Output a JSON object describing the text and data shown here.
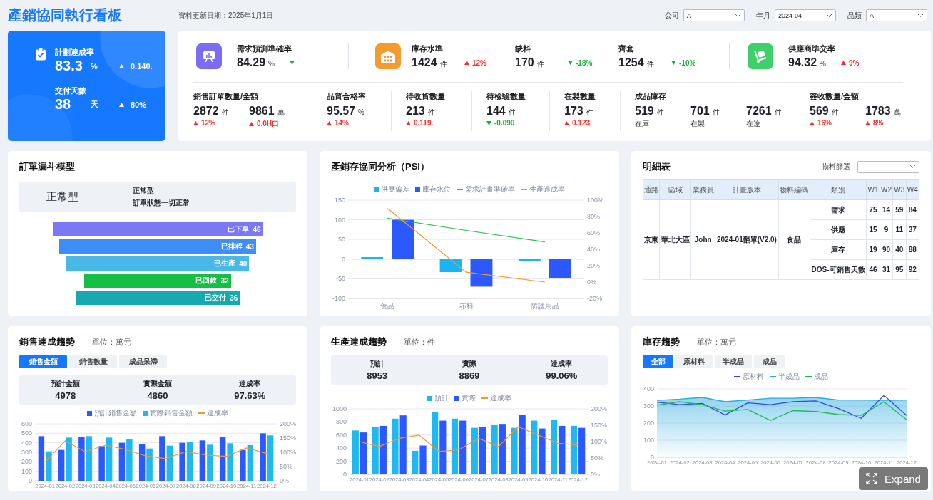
{
  "header": {
    "title": "產銷協同執行看板",
    "update_date": "資料更新日期：2025年1月1日",
    "filters": [
      {
        "label": "公司",
        "value": "A"
      },
      {
        "label": "年月",
        "value": "2024-04"
      },
      {
        "label": "品類",
        "value": "A"
      }
    ]
  },
  "summary_card": {
    "metrics": [
      {
        "label": "計劃達成率",
        "value": "83.3",
        "unit": "%",
        "change": "0.140.",
        "rising": true
      },
      {
        "label": "交付天數",
        "value": "38",
        "unit": "天",
        "change": "80%",
        "rising": true
      }
    ]
  },
  "kpi_panel": {
    "top_groups": [
      {
        "color": "#7b6cf6",
        "items": [
          {
            "label": "需求預測準確率",
            "value": "84.29",
            "unit": "%",
            "rising": false
          }
        ]
      },
      {
        "color": "#f59a2f",
        "items": [
          {
            "label": "庫存水準",
            "value": "1424",
            "unit": "件",
            "change": "12%",
            "rising": true
          },
          {
            "label": "缺料",
            "value": "170",
            "unit": "件",
            "change": "-18%",
            "rising": false
          },
          {
            "label": "齊套",
            "value": "1254",
            "unit": "件",
            "change": "-10%",
            "rising": false
          }
        ]
      },
      {
        "color": "#3ecf6a",
        "items": [
          {
            "label": "供應商準交率",
            "value": "94.32",
            "unit": "%",
            "change": "9%",
            "rising": true
          }
        ]
      }
    ],
    "bottom_groups": [
      {
        "label": "銷售訂單數量/金額",
        "items": [
          {
            "value": "2872",
            "unit": "件",
            "change": "12%",
            "rising": true
          },
          {
            "value": "9861",
            "unit": "萬",
            "change": "0.0H口",
            "rising": true
          }
        ]
      },
      {
        "label": "品質合格率",
        "items": [
          {
            "value": "95.57",
            "unit": "%",
            "change": "14%",
            "rising": true
          }
        ]
      },
      {
        "label": "待收貨數量",
        "items": [
          {
            "value": "213",
            "unit": "件",
            "change": "0.119.",
            "rising": true
          }
        ]
      },
      {
        "label": "待檢驗數量",
        "items": [
          {
            "value": "144",
            "unit": "件",
            "change": "-0.090",
            "rising": false
          }
        ]
      },
      {
        "label": "在製數量",
        "items": [
          {
            "value": "173",
            "unit": "件",
            "change": "0.123.",
            "rising": true
          }
        ]
      },
      {
        "label": "成品庫存",
        "items": [
          {
            "value": "519",
            "unit": "件",
            "note": "在庫"
          },
          {
            "value": "701",
            "unit": "件",
            "note": "在製"
          },
          {
            "value": "7261",
            "unit": "件",
            "note": "在途"
          }
        ]
      },
      {
        "label": "簽收數量/金額",
        "items": [
          {
            "value": "569",
            "unit": "件",
            "change": "16%",
            "rising": true
          },
          {
            "value": "1783",
            "unit": "萬",
            "change": "8%",
            "rising": true
          }
        ]
      }
    ]
  },
  "funnel_panel": {
    "title": "訂單漏斗模型",
    "summary": {
      "type_label": "正常型",
      "name": "正常型",
      "description": "訂單狀態一切正常"
    },
    "stages": [
      {
        "label": "已下單",
        "value": "46",
        "color": "#7b77f5"
      },
      {
        "label": "已排程",
        "value": "43",
        "color": "#3d8ef8"
      },
      {
        "label": "已生產",
        "value": "40",
        "color": "#47b8e8"
      },
      {
        "label": "已回款",
        "value": "32",
        "color": "#16be45"
      },
      {
        "label": "已交付",
        "value": "36",
        "color": "#17a9b0"
      }
    ]
  },
  "psi_panel": {
    "title": "產銷存協同分析（PSI）",
    "chart_data": {
      "type": "bar",
      "grid": true,
      "categories": [
        "食品",
        "布料",
        "防護用品"
      ],
      "ylim": [
        -100,
        150
      ],
      "yticks": [
        -100,
        -50,
        0,
        50,
        100,
        150
      ],
      "y2lim": [
        -20,
        100
      ],
      "y2ticks": [
        {
          "value": -20,
          "label": "-20%"
        },
        {
          "value": 0,
          "label": "0%"
        },
        {
          "value": 20,
          "label": "20%"
        },
        {
          "value": 40,
          "label": "40%"
        },
        {
          "value": 60,
          "label": "60%"
        },
        {
          "value": 80,
          "label": "80%"
        },
        {
          "value": 100,
          "label": "100%"
        }
      ],
      "series": [
        {
          "name": "供應偏差",
          "type": "bar",
          "color": "#1ab4f0",
          "values": [
            5,
            -33,
            -5
          ]
        },
        {
          "name": "庫存水位",
          "type": "bar",
          "color": "#2b58ff",
          "values": [
            100,
            -70,
            -48
          ]
        },
        {
          "name": "需求計畫準確率",
          "type": "line",
          "axis": "y2",
          "color": "#2dbf4e",
          "values": [
            78,
            63,
            49
          ]
        },
        {
          "name": "生產達成率",
          "type": "line",
          "axis": "y2",
          "color": "#f39a2b",
          "values": [
            90,
            12,
            0
          ]
        }
      ]
    }
  },
  "detail_panel": {
    "title": "明細表",
    "filter_label": "物料篩選",
    "columns": [
      "通路",
      "區域",
      "業務員",
      "計畫版本",
      "物料編碼",
      "類別",
      "W1",
      "W2",
      "W3",
      "W4"
    ],
    "merged_cells": [
      "京東",
      "華北大區",
      "John",
      "2024-01翻單(V2.0)",
      "食品"
    ],
    "rows": [
      {
        "category": "需求",
        "values": [
          "75",
          "14",
          "59",
          "84"
        ]
      },
      {
        "category": "供應",
        "values": [
          "15",
          "9",
          "11",
          "37"
        ]
      },
      {
        "category": "庫存",
        "values": [
          "19",
          "90",
          "40",
          "88"
        ]
      },
      {
        "category": "DOS-可銷售天數",
        "values": [
          "46",
          "31",
          "95",
          "92"
        ]
      }
    ]
  },
  "sales_panel": {
    "title": "銷售達成趨勢",
    "unit": "單位：萬元",
    "tabs": [
      {
        "label": "銷售金額",
        "selected": true
      },
      {
        "label": "銷售數量",
        "selected": false
      },
      {
        "label": "成品呆滯",
        "selected": false
      }
    ],
    "stats": [
      {
        "label": "預計金額",
        "value": "4978"
      },
      {
        "label": "實際金額",
        "value": "4860"
      },
      {
        "label": "達成率",
        "value": "97.63%"
      }
    ],
    "chart_data": {
      "type": "bar",
      "grid": true,
      "categories": [
        "2024-01",
        "2024-02",
        "2024-03",
        "2024-04",
        "2024-05",
        "2024-06",
        "2024-07",
        "2024-08",
        "2024-09",
        "2024-10",
        "2024-11",
        "2024-12"
      ],
      "ylim": [
        0,
        600
      ],
      "yticks": [
        0,
        100,
        200,
        300,
        400,
        500,
        600
      ],
      "y2lim": [
        0,
        200
      ],
      "y2ticks": [
        {
          "value": 0,
          "label": "0%"
        },
        {
          "value": 50,
          "label": "50%"
        },
        {
          "value": 100,
          "label": "100%"
        },
        {
          "value": 150,
          "label": "150%"
        },
        {
          "value": 200,
          "label": "200%"
        }
      ],
      "series": [
        {
          "name": "預計銷售金額",
          "type": "bar",
          "color": "#2b58ff",
          "values": [
            470,
            325,
            460,
            365,
            400,
            390,
            470,
            400,
            425,
            460,
            325,
            500
          ]
        },
        {
          "name": "實際銷售金額",
          "type": "bar",
          "color": "#1fb8f0",
          "values": [
            310,
            455,
            470,
            455,
            440,
            340,
            370,
            410,
            380,
            395,
            375,
            478
          ]
        },
        {
          "name": "達成率",
          "type": "line",
          "axis": "y2",
          "color": "#f39a2b",
          "values": [
            66,
            140,
            102,
            125,
            110,
            87,
            78,
            103,
            90,
            86,
            115,
            96
          ]
        }
      ]
    }
  },
  "production_panel": {
    "title": "生產達成趨勢",
    "unit": "單位：件",
    "stats": [
      {
        "label": "預計",
        "value": "8953"
      },
      {
        "label": "實際",
        "value": "8869"
      },
      {
        "label": "達成率",
        "value": "99.06%"
      }
    ],
    "chart_data": {
      "type": "bar",
      "grid": true,
      "categories": [
        "2024-01",
        "2024-02",
        "2024-03",
        "2024-04",
        "2024-05",
        "2024-06",
        "2024-07",
        "2024-08",
        "2024-09",
        "2024-10",
        "2024-11",
        "2024-12"
      ],
      "ylim": [
        0,
        1000
      ],
      "yticks": [
        0,
        200,
        400,
        600,
        800,
        1000
      ],
      "y2lim": [
        0,
        200
      ],
      "y2ticks": [
        {
          "value": 0,
          "label": "0%"
        },
        {
          "value": 50,
          "label": "50%"
        },
        {
          "value": 100,
          "label": "100%"
        },
        {
          "value": 150,
          "label": "150%"
        },
        {
          "value": 200,
          "label": "200%"
        }
      ],
      "series": [
        {
          "name": "預計",
          "type": "bar",
          "color": "#1fb8f0",
          "values": [
            670,
            720,
            850,
            360,
            950,
            850,
            710,
            750,
            710,
            820,
            830,
            740
          ]
        },
        {
          "name": "實際",
          "type": "bar",
          "color": "#2b58ff",
          "values": [
            640,
            740,
            900,
            440,
            820,
            820,
            720,
            770,
            910,
            700,
            740,
            710
          ]
        },
        {
          "name": "達成率",
          "type": "line",
          "axis": "y2",
          "color": "#f39a2b",
          "values": [
            100,
            85,
            110,
            120,
            70,
            75,
            110,
            85,
            145,
            120,
            95,
            90
          ]
        }
      ]
    }
  },
  "inventory_panel": {
    "title": "庫存趨勢",
    "unit": "單位：萬元",
    "tabs": [
      {
        "label": "全部",
        "selected": true
      },
      {
        "label": "原材料",
        "selected": false
      },
      {
        "label": "半成品",
        "selected": false
      },
      {
        "label": "成品",
        "selected": false
      }
    ],
    "chart_data": {
      "type": "area",
      "grid": true,
      "categories": [
        "2024-01",
        "2024-02",
        "2024-03",
        "2024-04",
        "2024-05",
        "2024-06",
        "2024-07",
        "2024-08",
        "2024-09",
        "2024-10",
        "2024-11",
        "2024-12"
      ],
      "ylim": [
        0,
        400
      ],
      "yticks": [
        0,
        100,
        200,
        300,
        400
      ],
      "series": [
        {
          "name": "原材料",
          "type": "line",
          "color": "#3346e8",
          "values": [
            322,
            308,
            315,
            248,
            318,
            308,
            326,
            330,
            285,
            228,
            362,
            245
          ]
        },
        {
          "name": "半成品",
          "type": "area",
          "color": "#27a9e1",
          "values": [
            333,
            340,
            350,
            325,
            335,
            345,
            345,
            350,
            335,
            335,
            333,
            335
          ]
        },
        {
          "name": "成品",
          "type": "line",
          "color": "#1fb84a",
          "values": [
            305,
            325,
            308,
            270,
            280,
            215,
            273,
            268,
            250,
            245,
            325,
            220
          ]
        }
      ]
    }
  },
  "expand_button": {
    "label": "Expand"
  }
}
